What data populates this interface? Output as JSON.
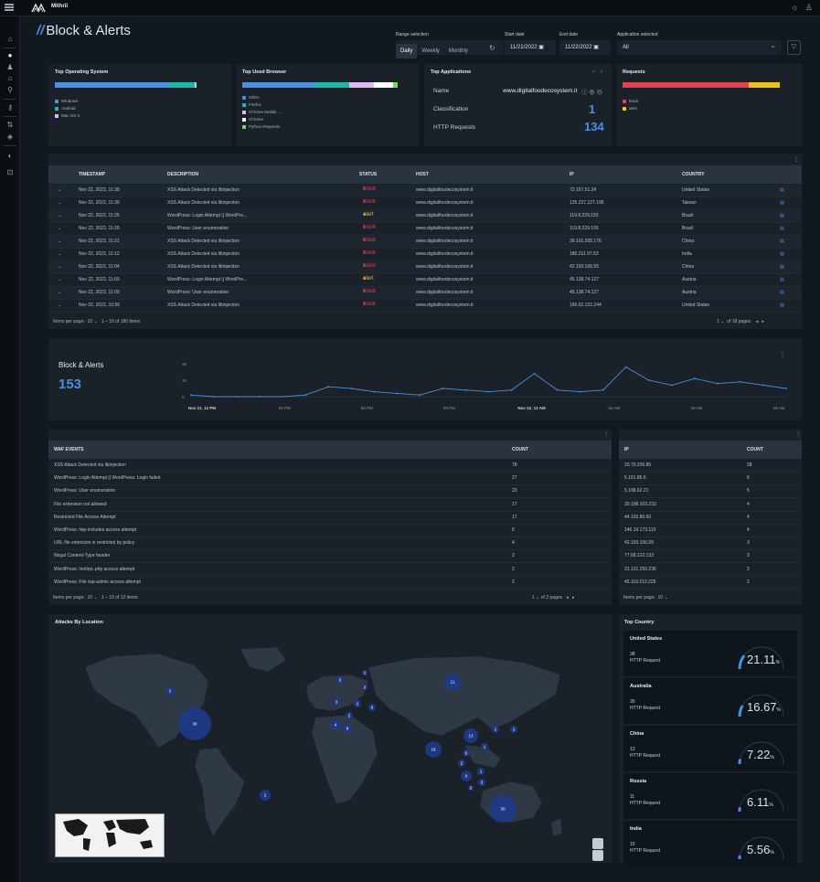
{
  "app": {
    "brand": "Mithril"
  },
  "page": {
    "title": "Block & Alerts"
  },
  "filters": {
    "range_label": "Range selection",
    "ranges": [
      "Daily",
      "Weekly",
      "Monthly"
    ],
    "start_label": "Start date",
    "start_value": "11/21/2022",
    "end_label": "End date",
    "end_value": "11/22/2022",
    "app_label": "Application selected",
    "app_value": "All"
  },
  "os_card": {
    "title": "Top Operating System",
    "items": [
      {
        "label": "Windows",
        "color": "#4a8fe0",
        "share": 0.7
      },
      {
        "label": "Android",
        "color": "#1fb5a8",
        "share": 0.15
      },
      {
        "label": "Mac OS X",
        "color": "#e2b6f2",
        "share": 0.01
      }
    ]
  },
  "browser_card": {
    "title": "Top Used Browser",
    "items": [
      {
        "label": "Other",
        "color": "#4a8fe0",
        "share": 0.46
      },
      {
        "label": "Firefox",
        "color": "#1fb5a8",
        "share": 0.22
      },
      {
        "label": "Chrome Mobile ...",
        "color": "#e2b6f2",
        "share": 0.16
      },
      {
        "label": "Chrome",
        "color": "#ffffff",
        "share": 0.12
      },
      {
        "label": "Python Requests",
        "color": "#7ad36a",
        "share": 0.03
      }
    ]
  },
  "apps_card": {
    "title": "Top Applications",
    "name_label": "Name",
    "name_value": "www.digitalfoodecosystem.it",
    "class_label": "Classification",
    "class_value": "1",
    "http_label": "HTTP Requests",
    "http_value": "134"
  },
  "requests_card": {
    "title": "Requests",
    "items": [
      {
        "label": "block",
        "color": "#e2424e",
        "share": 0.8
      },
      {
        "label": "alert",
        "color": "#f0c020",
        "share": 0.2
      }
    ]
  },
  "events_table": {
    "headers": [
      "TIMESTAMP",
      "DESCRIPTION",
      "STATUS",
      "HOST",
      "IP",
      "COUNTRY"
    ],
    "rows": [
      [
        "Nov 22, 2022, 11:39",
        "XSS Attack Detected via libinjection",
        "block",
        "www.digitalfoodecosystem.it",
        "72.167.51.34",
        "United States"
      ],
      [
        "Nov 22, 2022, 11:30",
        "XSS Attack Detected via libinjection",
        "block",
        "www.digitalfoodecosystem.it",
        "125.227.127.195",
        "Taiwan"
      ],
      [
        "Nov 22, 2022, 11:25",
        "WordPress: Login Attempt || WordPre...",
        "alert",
        "www.digitalfoodecosystem.it",
        "119.8.229.155",
        "Brazil"
      ],
      [
        "Nov 22, 2022, 11:25",
        "WordPress: User enumeration",
        "block",
        "www.digitalfoodecosystem.it",
        "119.8.229.155",
        "Brazil"
      ],
      [
        "Nov 22, 2022, 11:21",
        "XSS Attack Detected via libinjection",
        "block",
        "www.digitalfoodecosystem.it",
        "39.101.205.176",
        "China"
      ],
      [
        "Nov 22, 2022, 11:12",
        "XSS Attack Detected via libinjection",
        "block",
        "www.digitalfoodecosystem.it",
        "180.211.97.53",
        "India"
      ],
      [
        "Nov 22, 2022, 11:04",
        "XSS Attack Detected via libinjection",
        "block",
        "www.digitalfoodecosystem.it",
        "42.193.106.55",
        "China"
      ],
      [
        "Nov 22, 2022, 11:00",
        "WordPress: Login Attempt || WordPre...",
        "alert",
        "www.digitalfoodecosystem.it",
        "45.138.74.127",
        "Austria"
      ],
      [
        "Nov 22, 2022, 11:00",
        "WordPress: User enumeration",
        "block",
        "www.digitalfoodecosystem.it",
        "45.138.74.127",
        "Austria"
      ],
      [
        "Nov 22, 2022, 10:56",
        "XSS Attack Detected via libinjection",
        "block",
        "www.digitalfoodecosystem.it",
        "166.62.122.244",
        "United States"
      ]
    ],
    "items_per_page_label": "Items per page:",
    "items_per_page": "10",
    "range_text": "1 – 10 of 180 items",
    "page_value": "1",
    "pages_text": "of 18 pages"
  },
  "timeline": {
    "title": "Block & Alerts",
    "total": "153"
  },
  "chart_data": {
    "type": "line",
    "yticks": [
      "20",
      "10",
      "0"
    ],
    "ylim": [
      0,
      20
    ],
    "xticks": [
      "Nov 21, 12 PM",
      "03 PM",
      "06 PM",
      "09 PM",
      "Nov 22, 12 AM",
      "03 AM",
      "06 AM",
      "09 AM"
    ],
    "values": [
      1,
      0,
      0,
      0,
      0,
      1,
      6,
      5,
      3,
      2,
      1,
      5,
      4,
      3,
      4,
      14,
      4,
      3,
      4,
      18,
      10,
      7,
      11,
      8,
      9,
      7,
      5
    ]
  },
  "waf_table": {
    "headers": [
      "WAF EVENTS",
      "COUNT"
    ],
    "rows": [
      [
        "XSS Attack Detected via libinjection",
        "78"
      ],
      [
        "WordPress: Login Attempt || WordPress: Login failed",
        "27"
      ],
      [
        "WordPress: User enumeration",
        "23"
      ],
      [
        "File extension not allowed",
        "17"
      ],
      [
        "Restricted File Access Attempt",
        "17"
      ],
      [
        "WordPress: /wp-includes access attempt",
        "6"
      ],
      [
        "URL file extension is restricted by policy",
        "4"
      ],
      [
        "Illegal Content-Type header",
        "2"
      ],
      [
        "WordPress: /xmlrpc.php access attempt",
        "2"
      ],
      [
        "WordPress: File /wp-admin access attempt",
        "2"
      ]
    ],
    "items_per_page_label": "Items per page:",
    "items_per_page": "10",
    "range_text": "1 – 10 of 12 items",
    "page_value": "1",
    "pages_text": "of 2 pages"
  },
  "ip_table": {
    "headers": [
      "IP",
      "COUNT"
    ],
    "rows": [
      [
        "20.70.236.85",
        "28"
      ],
      [
        "5.181.86.5",
        "6"
      ],
      [
        "5.188.62.21",
        "5"
      ],
      [
        "20.198.103.233",
        "4"
      ],
      [
        "44.192.86.60",
        "4"
      ],
      [
        "146.19.173.115",
        "4"
      ],
      [
        "42.193.106.55",
        "3"
      ],
      [
        "77.68.122.133",
        "3"
      ],
      [
        "31.131.250.236",
        "2"
      ],
      [
        "45.119.213.225",
        "2"
      ]
    ],
    "items_per_page_label": "Items per page:",
    "items_per_page": "10"
  },
  "map": {
    "title": "Attacks By Location",
    "bubbles": [
      "2",
      "38",
      "2",
      "11",
      "5",
      "1",
      "2",
      "6",
      "3",
      "2",
      "2",
      "4",
      "8",
      "13",
      "18",
      "1",
      "1",
      "6",
      "1",
      "2",
      "9",
      "1",
      "3",
      "2",
      "30"
    ]
  },
  "top_country": {
    "title": "Top Country",
    "http_label": "HTTP Request",
    "items": [
      {
        "country": "United States",
        "count": "38",
        "pct": "21.11",
        "fraction": 0.2111
      },
      {
        "country": "Australia",
        "count": "30",
        "pct": "16.67",
        "fraction": 0.1667
      },
      {
        "country": "China",
        "count": "13",
        "pct": "7.22",
        "fraction": 0.0722
      },
      {
        "country": "Russia",
        "count": "11",
        "pct": "6.11",
        "fraction": 0.0611
      },
      {
        "country": "India",
        "count": "10",
        "pct": "5.56",
        "fraction": 0.0556
      }
    ]
  },
  "colors": {
    "accent": "#4a8fe0",
    "block": "#e2424e",
    "alert": "#f0c020",
    "bubble": "#1e3a8a"
  }
}
